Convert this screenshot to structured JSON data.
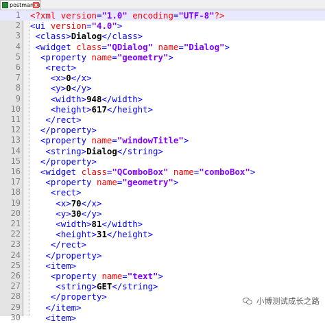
{
  "tab": {
    "label": "postman.ui",
    "close_glyph": "x"
  },
  "editor": {
    "current_line": 1,
    "lines": [
      {
        "num": "1",
        "tokens": [
          {
            "t": "pi",
            "v": "<?xml "
          },
          {
            "t": "attr",
            "v": "version"
          },
          {
            "t": "tag",
            "v": "="
          },
          {
            "t": "val",
            "v": "\"1.0\""
          },
          {
            "t": "attr",
            "v": " encoding"
          },
          {
            "t": "tag",
            "v": "="
          },
          {
            "t": "val",
            "v": "\"UTF-8\""
          },
          {
            "t": "pi",
            "v": "?>"
          }
        ]
      },
      {
        "num": "2",
        "tokens": [
          {
            "t": "tag",
            "v": "<ui "
          },
          {
            "t": "attr",
            "v": "version"
          },
          {
            "t": "tag",
            "v": "="
          },
          {
            "t": "val",
            "v": "\"4.0\""
          },
          {
            "t": "tag",
            "v": ">"
          }
        ]
      },
      {
        "num": "3",
        "tokens": [
          {
            "t": "tag",
            "v": " <class>"
          },
          {
            "t": "text",
            "v": "Dialog"
          },
          {
            "t": "tag",
            "v": "</class>"
          }
        ]
      },
      {
        "num": "4",
        "tokens": [
          {
            "t": "tag",
            "v": " <widget "
          },
          {
            "t": "attr",
            "v": "class"
          },
          {
            "t": "tag",
            "v": "="
          },
          {
            "t": "val",
            "v": "\"QDialog\""
          },
          {
            "t": "attr",
            "v": " name"
          },
          {
            "t": "tag",
            "v": "="
          },
          {
            "t": "val",
            "v": "\"Dialog\""
          },
          {
            "t": "tag",
            "v": ">"
          }
        ]
      },
      {
        "num": "5",
        "tokens": [
          {
            "t": "tag",
            "v": "  <property "
          },
          {
            "t": "attr",
            "v": "name"
          },
          {
            "t": "tag",
            "v": "="
          },
          {
            "t": "val",
            "v": "\"geometry\""
          },
          {
            "t": "tag",
            "v": ">"
          }
        ]
      },
      {
        "num": "6",
        "tokens": [
          {
            "t": "tag",
            "v": "   <rect>"
          }
        ]
      },
      {
        "num": "7",
        "tokens": [
          {
            "t": "tag",
            "v": "    <x>"
          },
          {
            "t": "text",
            "v": "0"
          },
          {
            "t": "tag",
            "v": "</x>"
          }
        ]
      },
      {
        "num": "8",
        "tokens": [
          {
            "t": "tag",
            "v": "    <y>"
          },
          {
            "t": "text",
            "v": "0"
          },
          {
            "t": "tag",
            "v": "</y>"
          }
        ]
      },
      {
        "num": "9",
        "tokens": [
          {
            "t": "tag",
            "v": "    <width>"
          },
          {
            "t": "text",
            "v": "948"
          },
          {
            "t": "tag",
            "v": "</width>"
          }
        ]
      },
      {
        "num": "10",
        "tokens": [
          {
            "t": "tag",
            "v": "    <height>"
          },
          {
            "t": "text",
            "v": "617"
          },
          {
            "t": "tag",
            "v": "</height>"
          }
        ]
      },
      {
        "num": "11",
        "tokens": [
          {
            "t": "tag",
            "v": "   </rect>"
          }
        ]
      },
      {
        "num": "12",
        "tokens": [
          {
            "t": "tag",
            "v": "  </property>"
          }
        ]
      },
      {
        "num": "13",
        "tokens": [
          {
            "t": "tag",
            "v": "  <property "
          },
          {
            "t": "attr",
            "v": "name"
          },
          {
            "t": "tag",
            "v": "="
          },
          {
            "t": "val",
            "v": "\"windowTitle\""
          },
          {
            "t": "tag",
            "v": ">"
          }
        ]
      },
      {
        "num": "14",
        "tokens": [
          {
            "t": "tag",
            "v": "   <string>"
          },
          {
            "t": "text",
            "v": "Dialog"
          },
          {
            "t": "tag",
            "v": "</string>"
          }
        ]
      },
      {
        "num": "15",
        "tokens": [
          {
            "t": "tag",
            "v": "  </property>"
          }
        ]
      },
      {
        "num": "16",
        "tokens": [
          {
            "t": "tag",
            "v": "  <widget "
          },
          {
            "t": "attr",
            "v": "class"
          },
          {
            "t": "tag",
            "v": "="
          },
          {
            "t": "val",
            "v": "\"QComboBox\""
          },
          {
            "t": "attr",
            "v": " name"
          },
          {
            "t": "tag",
            "v": "="
          },
          {
            "t": "val",
            "v": "\"comboBox\""
          },
          {
            "t": "tag",
            "v": ">"
          }
        ]
      },
      {
        "num": "17",
        "tokens": [
          {
            "t": "tag",
            "v": "   <property "
          },
          {
            "t": "attr",
            "v": "name"
          },
          {
            "t": "tag",
            "v": "="
          },
          {
            "t": "val",
            "v": "\"geometry\""
          },
          {
            "t": "tag",
            "v": ">"
          }
        ]
      },
      {
        "num": "18",
        "tokens": [
          {
            "t": "tag",
            "v": "    <rect>"
          }
        ]
      },
      {
        "num": "19",
        "tokens": [
          {
            "t": "tag",
            "v": "     <x>"
          },
          {
            "t": "text",
            "v": "70"
          },
          {
            "t": "tag",
            "v": "</x>"
          }
        ]
      },
      {
        "num": "20",
        "tokens": [
          {
            "t": "tag",
            "v": "     <y>"
          },
          {
            "t": "text",
            "v": "30"
          },
          {
            "t": "tag",
            "v": "</y>"
          }
        ]
      },
      {
        "num": "21",
        "tokens": [
          {
            "t": "tag",
            "v": "     <width>"
          },
          {
            "t": "text",
            "v": "81"
          },
          {
            "t": "tag",
            "v": "</width>"
          }
        ]
      },
      {
        "num": "22",
        "tokens": [
          {
            "t": "tag",
            "v": "     <height>"
          },
          {
            "t": "text",
            "v": "31"
          },
          {
            "t": "tag",
            "v": "</height>"
          }
        ]
      },
      {
        "num": "23",
        "tokens": [
          {
            "t": "tag",
            "v": "    </rect>"
          }
        ]
      },
      {
        "num": "24",
        "tokens": [
          {
            "t": "tag",
            "v": "   </property>"
          }
        ]
      },
      {
        "num": "25",
        "tokens": [
          {
            "t": "tag",
            "v": "   <item>"
          }
        ]
      },
      {
        "num": "26",
        "tokens": [
          {
            "t": "tag",
            "v": "    <property "
          },
          {
            "t": "attr",
            "v": "name"
          },
          {
            "t": "tag",
            "v": "="
          },
          {
            "t": "val",
            "v": "\"text\""
          },
          {
            "t": "tag",
            "v": ">"
          }
        ]
      },
      {
        "num": "27",
        "tokens": [
          {
            "t": "tag",
            "v": "     <string>"
          },
          {
            "t": "text",
            "v": "GET"
          },
          {
            "t": "tag",
            "v": "</string>"
          }
        ]
      },
      {
        "num": "28",
        "tokens": [
          {
            "t": "tag",
            "v": "    </property>"
          }
        ]
      },
      {
        "num": "29",
        "tokens": [
          {
            "t": "tag",
            "v": "   </item>"
          }
        ]
      },
      {
        "num": "30",
        "tokens": [
          {
            "t": "tag",
            "v": "   <item>"
          }
        ]
      }
    ]
  },
  "watermark": {
    "text": "小博测试成长之路",
    "icon": "wechat-icon"
  },
  "colors": {
    "tag": "#0000ff",
    "attr": "#ff0000",
    "value": "#8000ff",
    "text": "#000000",
    "gutter": "#e4e4e4"
  }
}
